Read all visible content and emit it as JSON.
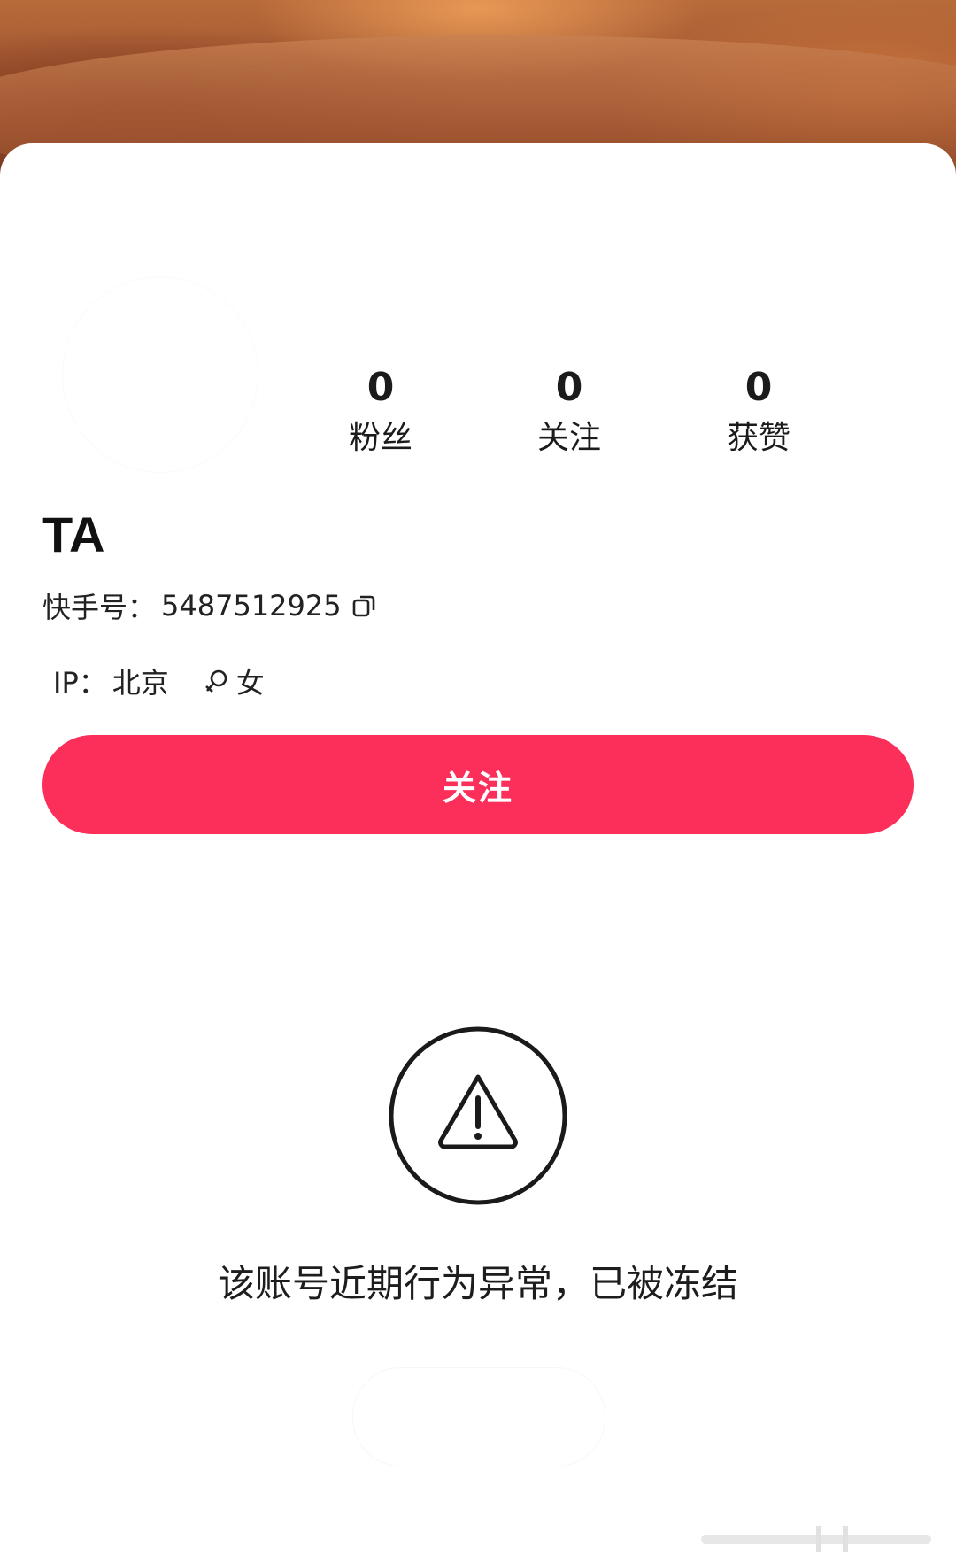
{
  "profile": {
    "stats": [
      {
        "key": "fans",
        "value": "0",
        "label": "粉丝"
      },
      {
        "key": "following",
        "value": "0",
        "label": "关注"
      },
      {
        "key": "likes",
        "value": "0",
        "label": "获赞"
      }
    ],
    "username": "TA",
    "kuaishou_id_label": "快手号：",
    "kuaishou_id": "5487512925",
    "ip_label": "IP：",
    "ip_location": "北京",
    "gender": "女"
  },
  "actions": {
    "follow_label": "关注"
  },
  "notice": {
    "message": "该账号近期行为异常，已被冻结"
  },
  "icons": {
    "copy": "copy-icon",
    "gender": "female-icon",
    "warning": "warning-icon"
  },
  "colors": {
    "accent": "#fc2e5a",
    "text": "#1b1b1b",
    "background": "#ffffff"
  }
}
